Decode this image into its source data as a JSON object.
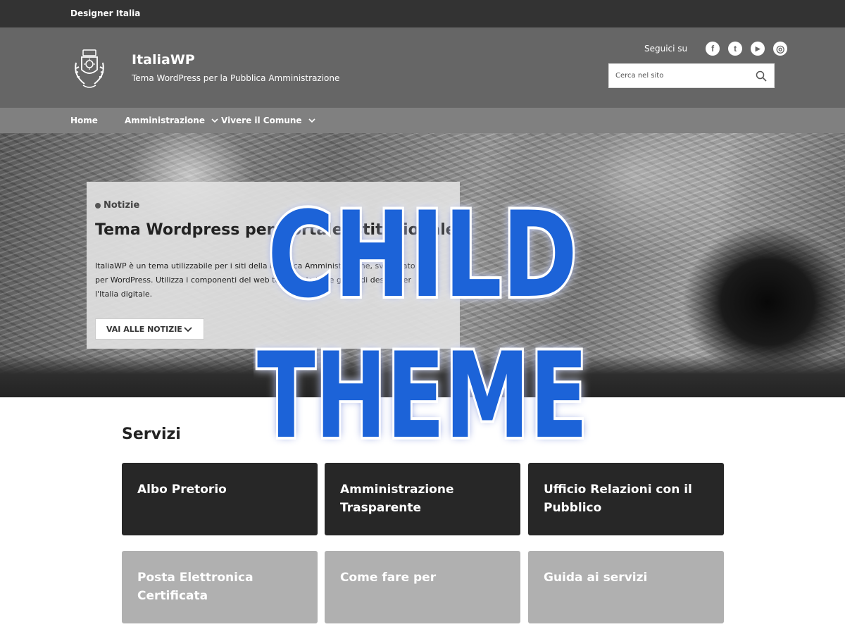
{
  "topbar": {
    "brand": "Designer Italia"
  },
  "header": {
    "title": "ItaliaWP",
    "tagline": "Tema WordPress per la Pubblica Amministrazione",
    "social_label": "Seguici su",
    "social": [
      {
        "name": "facebook-icon",
        "glyph": "f"
      },
      {
        "name": "twitter-icon",
        "glyph": "t"
      },
      {
        "name": "youtube-icon",
        "glyph": "▶"
      },
      {
        "name": "instagram-icon",
        "glyph": "◎"
      }
    ],
    "search_placeholder": "Cerca nel sito"
  },
  "nav": {
    "items": [
      {
        "label": "Home",
        "dropdown": false
      },
      {
        "label": "Amministrazione",
        "dropdown": true
      },
      {
        "label": "Vivere il Comune",
        "dropdown": true
      }
    ]
  },
  "hero": {
    "category": "Notizie",
    "title": "Tema Wordpress per portale istituzionale",
    "body": "ItaliaWP è un tema utilizzabile per i siti della Pubblica Amministrazione, sviluppato per WordPress. Utilizza i componenti del web toolkit e le linee guida di design per l'Italia digitale.",
    "button": "VAI ALLE NOTIZIE"
  },
  "overlay": {
    "line1": "CHILD",
    "line2": "THEME"
  },
  "services": {
    "title": "Servizi",
    "tiles": [
      {
        "label": "Albo Pretorio"
      },
      {
        "label": "Amministrazione Trasparente"
      },
      {
        "label": "Ufficio Relazioni con il Pubblico"
      },
      {
        "label": "Posta Elettronica Certificata"
      },
      {
        "label": "Come fare per"
      },
      {
        "label": "Guida ai servizi"
      }
    ]
  },
  "colors": {
    "topbar": "#333333",
    "header": "#666666",
    "nav": "#808080",
    "tile_dark": "#272727",
    "tile_light": "#b0b0b0",
    "overlay_text": "#1e63d8"
  }
}
